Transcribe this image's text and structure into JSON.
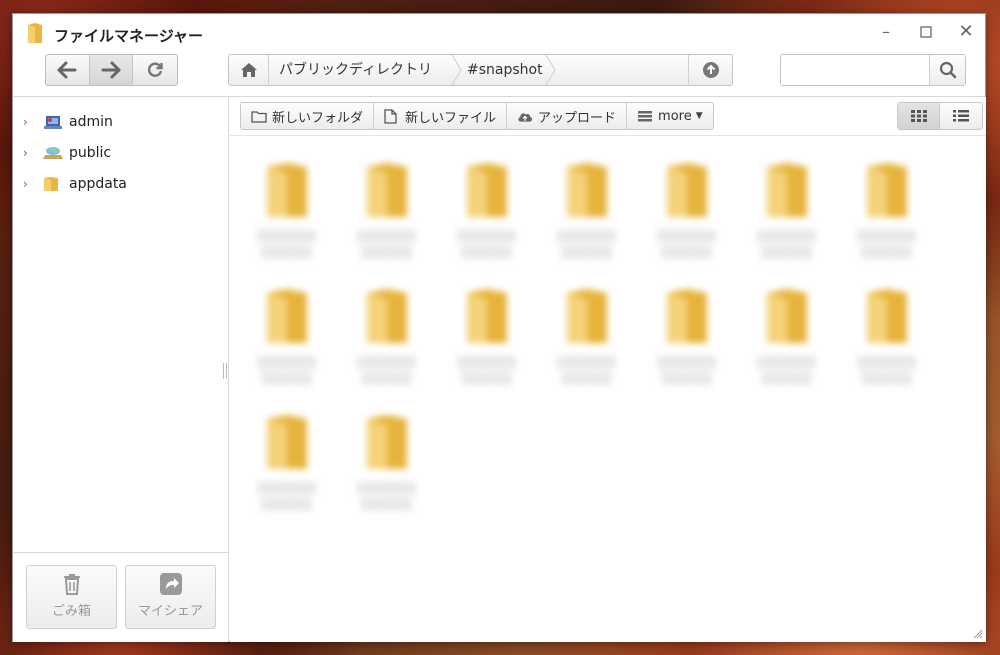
{
  "window": {
    "title": "ファイルマネージャー",
    "controls": [
      "minimize-icon",
      "maximize-icon",
      "close-icon"
    ]
  },
  "navigation": {
    "back_icon": "arrow-left-icon",
    "forward_icon": "arrow-right-icon",
    "refresh_icon": "refresh-icon"
  },
  "path": {
    "home_icon": "home-icon",
    "crumbs": [
      "パブリックディレクトリ",
      "#snapshot"
    ],
    "up_icon": "arrow-up-circle-icon"
  },
  "search": {
    "value": "",
    "placeholder": "",
    "icon": "search-icon"
  },
  "sidebar": {
    "items": [
      {
        "label": "admin",
        "icon": "user-home-icon"
      },
      {
        "label": "public",
        "icon": "public-share-icon"
      },
      {
        "label": "appdata",
        "icon": "folder-icon"
      }
    ],
    "footer": {
      "trash_label": "ごみ箱",
      "myshare_label": "マイシェア"
    }
  },
  "actions": {
    "new_folder": "新しいフォルダ",
    "new_file": "新しいファイル",
    "upload": "アップロード",
    "more": "more"
  },
  "view": {
    "grid_icon": "grid-view-icon",
    "list_icon": "list-view-icon",
    "active": "grid"
  },
  "colors": {
    "folder": "#f3c75a",
    "folder_dark": "#e0ac34",
    "accent_gray": "#666666"
  }
}
